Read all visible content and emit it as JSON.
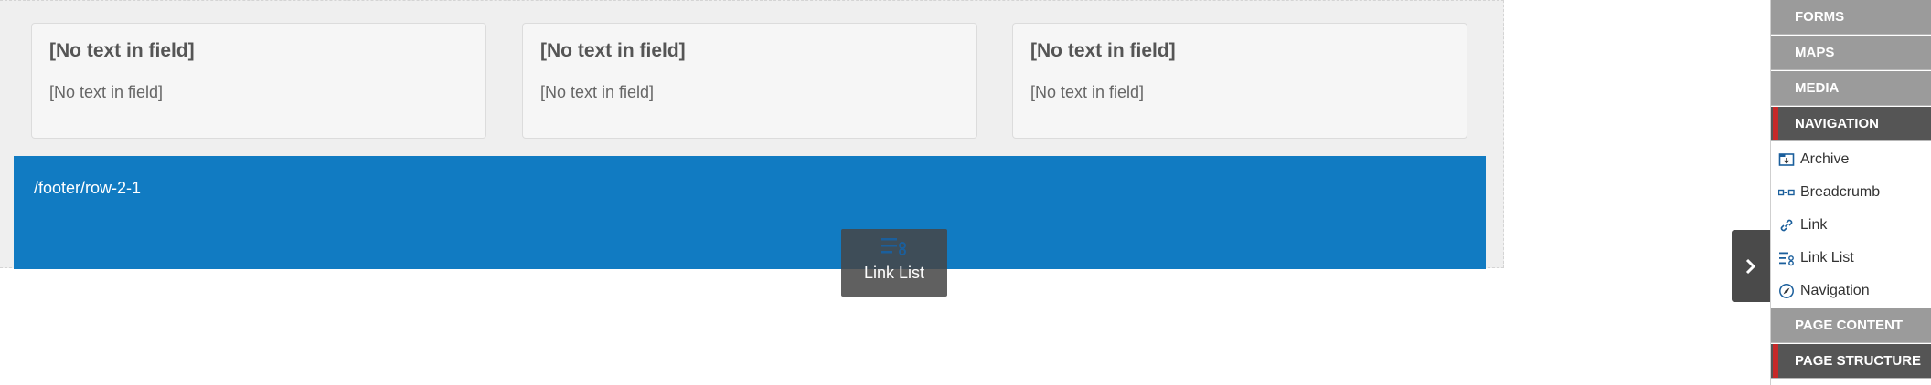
{
  "canvas": {
    "cards": [
      {
        "heading": "[No text in field]",
        "text": "[No text in field]"
      },
      {
        "heading": "[No text in field]",
        "text": "[No text in field]"
      },
      {
        "heading": "[No text in field]",
        "text": "[No text in field]"
      }
    ],
    "footer_row": {
      "path": "/footer/row-2-1"
    },
    "drag_tile": {
      "label": "Link List",
      "icon": "link-list-icon"
    }
  },
  "panel_toggle": {
    "icon": "chevron-right-icon"
  },
  "panel": {
    "categories_top": [
      {
        "label": "FORMS"
      },
      {
        "label": "MAPS"
      },
      {
        "label": "MEDIA"
      }
    ],
    "active_category": {
      "label": "NAVIGATION"
    },
    "items": [
      {
        "label": "Archive",
        "icon": "archive-icon"
      },
      {
        "label": "Breadcrumb",
        "icon": "breadcrumb-icon"
      },
      {
        "label": "Link",
        "icon": "link-icon"
      },
      {
        "label": "Link List",
        "icon": "link-list-icon"
      },
      {
        "label": "Navigation",
        "icon": "navigation-icon"
      }
    ],
    "categories_bottom": [
      {
        "label": "PAGE CONTENT"
      },
      {
        "label": "PAGE STRUCTURE"
      }
    ]
  },
  "colors": {
    "footer_row": "#117bc2",
    "active_marker": "#c62828",
    "category_bg": "#9b9b9b",
    "active_category_bg": "#555555"
  }
}
